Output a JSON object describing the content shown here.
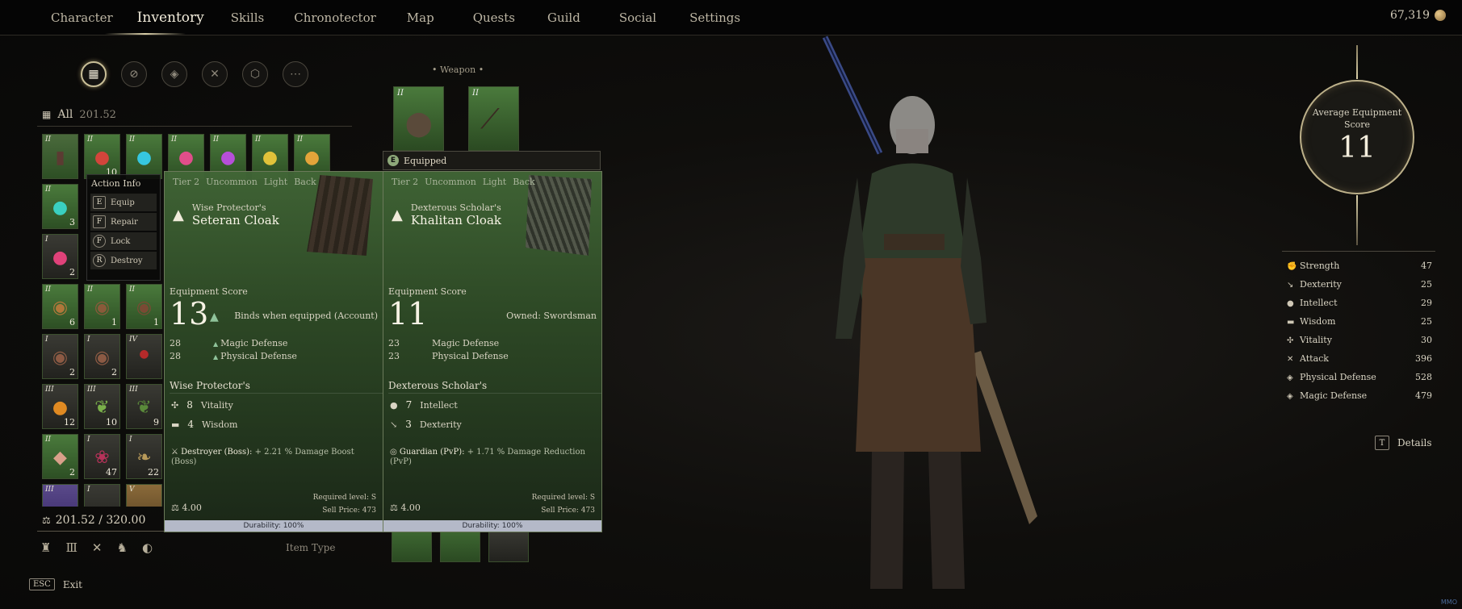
{
  "nav": {
    "items": [
      "Character",
      "Inventory",
      "Skills",
      "Chronotector",
      "Map",
      "Quests",
      "Guild",
      "Social",
      "Settings"
    ],
    "active": "Inventory",
    "currency": "67,319"
  },
  "filters": [
    "grid-icon",
    "sword-slash-icon",
    "armor-icon",
    "crossed-swords-icon",
    "box-icon",
    "more-icon"
  ],
  "inventory": {
    "all_label": "All",
    "weight": "201.52",
    "weight_total": "201.52 / 320.00",
    "item_type_label": "Item Type",
    "top_row": [
      {
        "tier": "II",
        "qty": ""
      },
      {
        "tier": "II",
        "qty": "10"
      },
      {
        "tier": "II",
        "qty": ""
      },
      {
        "tier": "II",
        "qty": ""
      },
      {
        "tier": "II",
        "qty": ""
      },
      {
        "tier": "II",
        "qty": ""
      },
      {
        "tier": "II",
        "qty": ""
      }
    ],
    "slots": [
      {
        "tier": "II",
        "qty": "3"
      },
      {
        "tier": "",
        "qty": ""
      },
      {
        "tier": "",
        "qty": ""
      },
      {
        "tier": "I",
        "qty": "2"
      },
      {
        "tier": "",
        "qty": ""
      },
      {
        "tier": "",
        "qty": ""
      },
      {
        "tier": "II",
        "qty": "6"
      },
      {
        "tier": "II",
        "qty": "1"
      },
      {
        "tier": "II",
        "qty": "1"
      },
      {
        "tier": "I",
        "qty": "2"
      },
      {
        "tier": "I",
        "qty": "2"
      },
      {
        "tier": "IV",
        "qty": ""
      },
      {
        "tier": "III",
        "qty": "12"
      },
      {
        "tier": "III",
        "qty": "10"
      },
      {
        "tier": "III",
        "qty": "9"
      },
      {
        "tier": "II",
        "qty": "2"
      },
      {
        "tier": "I",
        "qty": "47"
      },
      {
        "tier": "I",
        "qty": "22"
      },
      {
        "tier": "III",
        "qty": ""
      },
      {
        "tier": "I",
        "qty": ""
      },
      {
        "tier": "V",
        "qty": ""
      }
    ]
  },
  "action_info": {
    "title": "Action Info",
    "actions": [
      {
        "key": "E",
        "label": "Equip"
      },
      {
        "key": "F",
        "label": "Repair"
      },
      {
        "key": "F",
        "label": "Lock"
      },
      {
        "key": "R",
        "label": "Destroy"
      }
    ]
  },
  "weapon": {
    "label": "Weapon",
    "slot_tiers": [
      "II",
      "II"
    ]
  },
  "compare": {
    "left": {
      "tags": [
        "Tier 2",
        "Uncommon",
        "Light",
        "Back"
      ],
      "prefix": "Wise Protector's",
      "name": "Seteran Cloak",
      "score_label": "Equipment Score",
      "score": "13",
      "note": "Binds when equipped (Account)",
      "stats": [
        {
          "value": "28",
          "label": "Magic Defense"
        },
        {
          "value": "28",
          "label": "Physical Defense"
        }
      ],
      "sub_title": "Wise Protector's",
      "attrs": [
        {
          "value": "8",
          "label": "Vitality"
        },
        {
          "value": "4",
          "label": "Wisdom"
        }
      ],
      "set_name": "Destroyer (Boss):",
      "set_effect": "+ 2.21 % Damage Boost (Boss)",
      "required": "Required level: S",
      "sell": "Sell Price: 473",
      "weight": "4.00",
      "durability": "Durability: 100%"
    },
    "right": {
      "equipped_label": "Equipped",
      "equipped_key": "E",
      "tags": [
        "Tier 2",
        "Uncommon",
        "Light",
        "Back"
      ],
      "prefix": "Dexterous Scholar's",
      "name": "Khalitan Cloak",
      "score_label": "Equipment Score",
      "score": "11",
      "note": "Owned: Swordsman",
      "stats": [
        {
          "value": "23",
          "label": "Magic Defense"
        },
        {
          "value": "23",
          "label": "Physical Defense"
        }
      ],
      "sub_title": "Dexterous Scholar's",
      "attrs": [
        {
          "value": "7",
          "label": "Intellect"
        },
        {
          "value": "3",
          "label": "Dexterity"
        }
      ],
      "set_name": "Guardian (PvP):",
      "set_effect": "+ 1.71 % Damage Reduction (PvP)",
      "required": "Required level: S",
      "sell": "Sell Price: 473",
      "weight": "4.00",
      "durability": "Durability: 100%"
    }
  },
  "score": {
    "label": "Average Equipment Score",
    "value": "11"
  },
  "stats": [
    {
      "icon": "strength-icon",
      "label": "Strength",
      "value": "47"
    },
    {
      "icon": "dexterity-icon",
      "label": "Dexterity",
      "value": "25"
    },
    {
      "icon": "intellect-icon",
      "label": "Intellect",
      "value": "29"
    },
    {
      "icon": "wisdom-icon",
      "label": "Wisdom",
      "value": "25"
    },
    {
      "icon": "vitality-icon",
      "label": "Vitality",
      "value": "30"
    },
    {
      "icon": "attack-icon",
      "label": "Attack",
      "value": "396"
    },
    {
      "icon": "physical-defense-icon",
      "label": "Physical Defense",
      "value": "528"
    },
    {
      "icon": "magic-defense-icon",
      "label": "Magic Defense",
      "value": "479"
    }
  ],
  "details": {
    "key": "T",
    "label": "Details"
  },
  "exit": {
    "key": "ESC",
    "label": "Exit"
  },
  "watermark": "MMO"
}
